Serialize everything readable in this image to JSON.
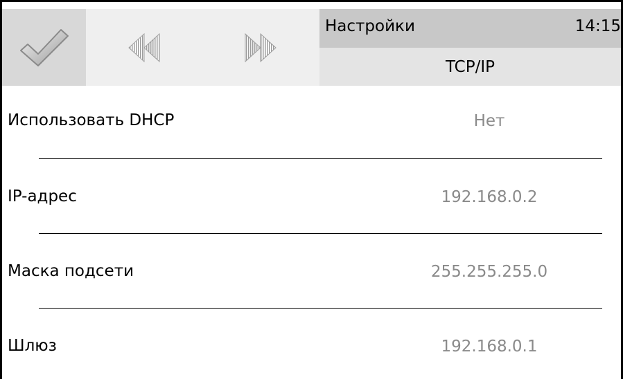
{
  "header": {
    "title": "Настройки",
    "clock": "14:15",
    "subtitle": "TCP/IP",
    "ok_icon": "checkmark-icon",
    "prev_icon": "rewind-icon",
    "next_icon": "fast-forward-icon"
  },
  "settings": [
    {
      "label": "Использовать DHCP",
      "value": "Нет"
    },
    {
      "label": "IP-адрес",
      "value": "192.168.0.2"
    },
    {
      "label": "Маска подсети",
      "value": "255.255.255.0"
    },
    {
      "label": "Шлюз",
      "value": "192.168.0.1"
    }
  ],
  "colors": {
    "value_text": "#8a8a8a",
    "title_bar": "#c8c8c8",
    "subtitle_bar": "#e4e4e4",
    "ok_button": "#d8d8d8",
    "nav_area": "#efefef"
  }
}
